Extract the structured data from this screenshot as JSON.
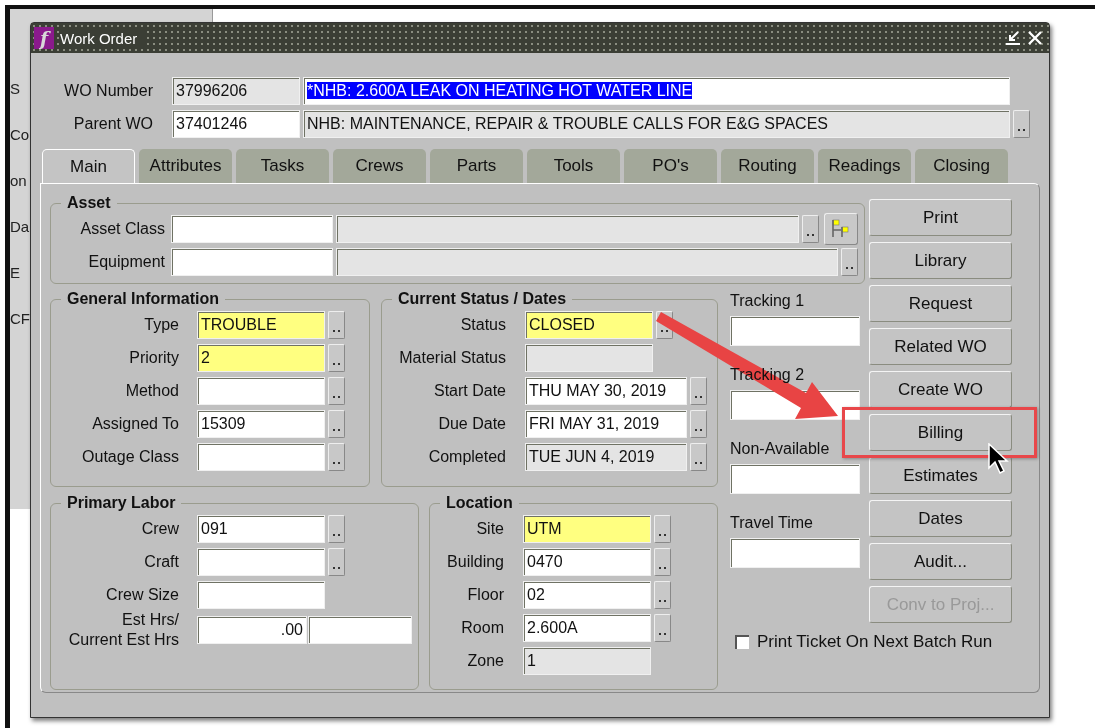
{
  "background_window": {
    "fragments": [
      "S",
      "Co",
      "on",
      "Da",
      "E",
      "CF"
    ]
  },
  "window": {
    "title": "Work Order",
    "icon_letter": "f"
  },
  "header": [
    {
      "label": "WO Number",
      "value": "37996206",
      "value_readonly": true,
      "description": "*NHB: 2.600A LEAK ON HEATING HOT WATER LINE",
      "description_readonly": false,
      "description_selected": true,
      "lookup": false
    },
    {
      "label": "Parent WO",
      "value": "37401246",
      "value_readonly": false,
      "description": "NHB: MAINTENANCE, REPAIR & TROUBLE CALLS FOR E&G SPACES",
      "description_readonly": true,
      "description_selected": false,
      "lookup": true
    }
  ],
  "tabs": [
    {
      "label": "Main",
      "selected": true
    },
    {
      "label": "Attributes",
      "selected": false
    },
    {
      "label": "Tasks",
      "selected": false
    },
    {
      "label": "Crews",
      "selected": false
    },
    {
      "label": "Parts",
      "selected": false
    },
    {
      "label": "Tools",
      "selected": false
    },
    {
      "label": "PO's",
      "selected": false
    },
    {
      "label": "Routing",
      "selected": false
    },
    {
      "label": "Readings",
      "selected": false
    },
    {
      "label": "Closing",
      "selected": false
    }
  ],
  "asset": {
    "title": "Asset",
    "rows": [
      {
        "label": "Asset Class",
        "lookup": true,
        "tree_button": true
      },
      {
        "label": "Equipment",
        "lookup": true,
        "tree_button": false
      }
    ]
  },
  "general_information": {
    "title": "General Information",
    "fields": [
      {
        "label": "Type",
        "value": "TROUBLE",
        "required": true,
        "readonly": false,
        "lookup": true
      },
      {
        "label": "Priority",
        "value": "2",
        "required": true,
        "readonly": false,
        "lookup": true
      },
      {
        "label": "Method",
        "required": false,
        "readonly": false,
        "lookup": true
      },
      {
        "label": "Assigned To",
        "value": "15309",
        "required": false,
        "readonly": false,
        "lookup": true
      },
      {
        "label": "Outage Class",
        "required": false,
        "readonly": false,
        "lookup": true
      }
    ]
  },
  "current_status": {
    "title": "Current Status / Dates",
    "fields": [
      {
        "kind": "code",
        "label": "Status",
        "value": "CLOSED",
        "required": true,
        "readonly": false,
        "lookup": true
      },
      {
        "kind": "code",
        "label": "Material Status",
        "required": false,
        "readonly": true,
        "lookup": false
      },
      {
        "kind": "date",
        "label": "Start Date",
        "value": "THU MAY 30, 2019",
        "required": false,
        "readonly": false,
        "lookup": true
      },
      {
        "kind": "date",
        "label": "Due Date",
        "value": "FRI MAY 31, 2019",
        "required": false,
        "readonly": false,
        "lookup": true
      },
      {
        "kind": "date",
        "label": "Completed",
        "value": "TUE JUN 4, 2019",
        "required": false,
        "readonly": true,
        "lookup": true
      }
    ]
  },
  "tracking": [
    {
      "label": "Tracking 1"
    },
    {
      "label": "Tracking 2"
    },
    {
      "label": "Non-Available"
    },
    {
      "label": "Travel Time"
    }
  ],
  "primary_labor": {
    "title": "Primary Labor",
    "fields": [
      {
        "kind": "single",
        "label": "Crew",
        "value": "091",
        "lookup": true
      },
      {
        "kind": "single",
        "label": "Craft",
        "lookup": true
      },
      {
        "kind": "single",
        "label": "Crew Size",
        "lookup": false
      },
      {
        "kind": "pair",
        "label": "Est Hrs/\nCurrent Est Hrs",
        "value": ".00",
        "lookup": false
      }
    ]
  },
  "location": {
    "title": "Location",
    "fields": [
      {
        "label": "Site",
        "value": "UTM",
        "required": true,
        "readonly": false,
        "lookup": true
      },
      {
        "label": "Building",
        "value": "0470",
        "required": false,
        "readonly": false,
        "lookup": true
      },
      {
        "label": "Floor",
        "value": "02",
        "required": false,
        "readonly": false,
        "lookup": true
      },
      {
        "label": "Room",
        "value": "2.600A",
        "required": false,
        "readonly": false,
        "lookup": true
      },
      {
        "label": "Zone",
        "value": "1",
        "required": false,
        "readonly": true,
        "lookup": false
      }
    ]
  },
  "buttons": [
    {
      "label": "Print",
      "disabled": false,
      "highlighted": false
    },
    {
      "label": "Library",
      "disabled": false,
      "highlighted": false
    },
    {
      "label": "Request",
      "disabled": false,
      "highlighted": false
    },
    {
      "label": "Related WO",
      "disabled": false,
      "highlighted": false
    },
    {
      "label": "Create WO",
      "disabled": false,
      "highlighted": false
    },
    {
      "label": "Billing",
      "disabled": false,
      "highlighted": true
    },
    {
      "label": "Estimates",
      "disabled": false,
      "highlighted": false
    },
    {
      "label": "Dates",
      "disabled": false,
      "highlighted": false
    },
    {
      "label": "Audit...",
      "disabled": false,
      "highlighted": false
    },
    {
      "label": "Conv to Proj...",
      "disabled": true,
      "highlighted": false
    }
  ],
  "print_ticket": {
    "label": "Print Ticket On Next Batch Run",
    "checked": false
  }
}
